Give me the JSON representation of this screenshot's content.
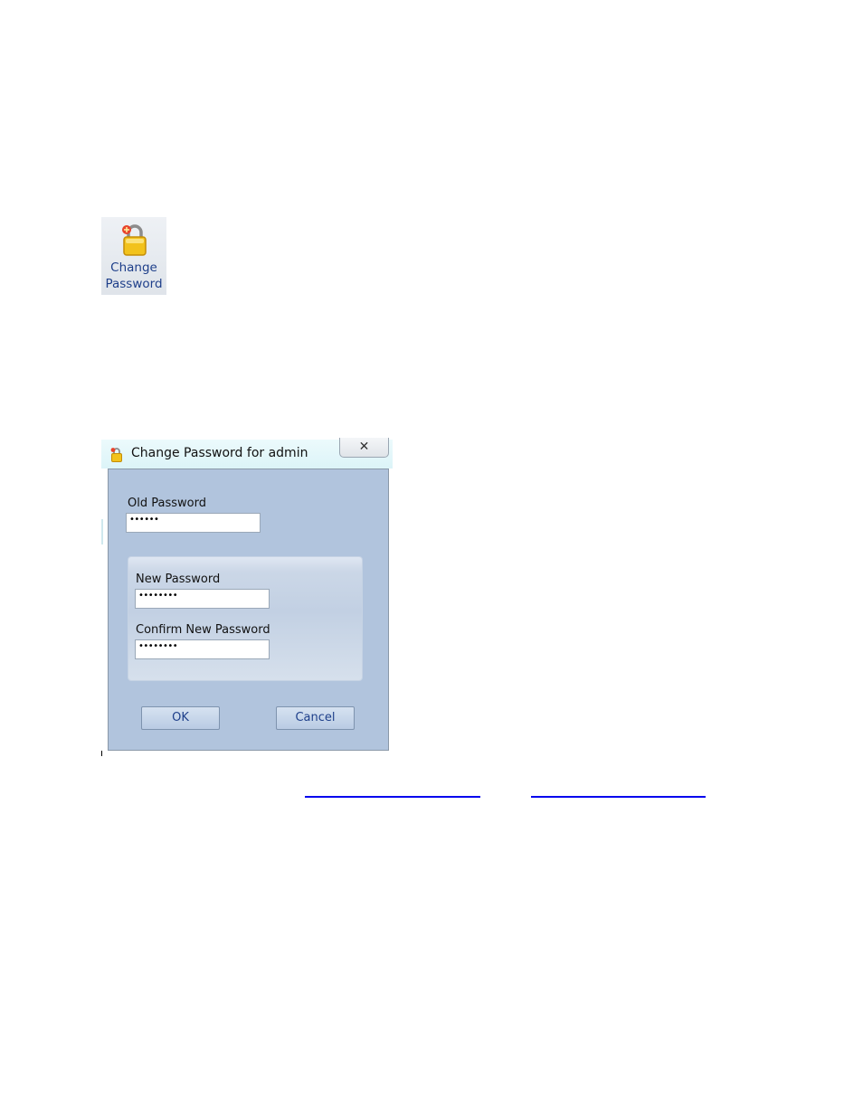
{
  "ribbon_button": {
    "label_line1": "Change",
    "label_line2": "Password",
    "icon": "padlock-icon"
  },
  "dialog": {
    "title": "Change Password for admin",
    "title_icon": "padlock-icon",
    "close_glyph": "✕",
    "old_password_label": "Old Password",
    "old_password_value": "••••••",
    "new_password_label": "New Password",
    "new_password_value": "••••••••",
    "confirm_password_label": "Confirm New Password",
    "confirm_password_value": "••••••••",
    "ok_label": "OK",
    "cancel_label": "Cancel"
  },
  "links": {
    "link1_text": "",
    "link2_text": ""
  },
  "colors": {
    "dialog_background": "#b1c4dd",
    "titlebar": "#dcf4f8",
    "link": "#0000ee",
    "button_text": "#1e3f8a"
  }
}
